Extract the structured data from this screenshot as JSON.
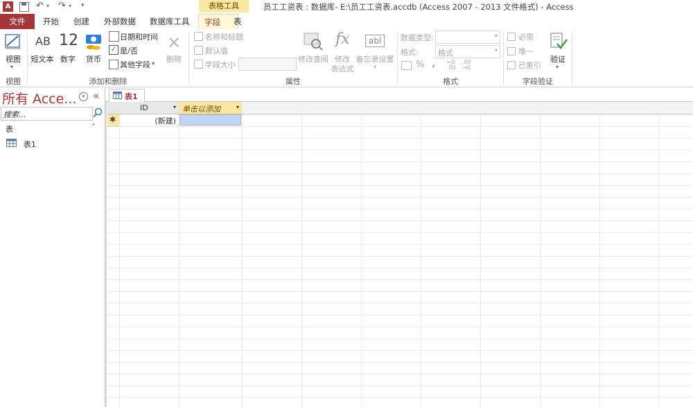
{
  "app": {
    "title": "员工工资表 : 数据库- E:\\员工工资表.accdb (Access 2007 - 2013 文件格式) - Access",
    "context_tab_header": "表格工具"
  },
  "tabs": [
    "文件",
    "开始",
    "创建",
    "外部数据",
    "数据库工具",
    "字段",
    "表"
  ],
  "active_tab": "字段",
  "ribbon": {
    "view": {
      "label": "视图",
      "group": "视图"
    },
    "add_delete": {
      "group": "添加和删除",
      "short_text": "短文本",
      "short_text_icon": "AB",
      "number": "数字",
      "number_icon": "12",
      "currency": "货币",
      "date_time": "日期和时间",
      "yes_no": "是/否",
      "more_fields": "其他字段",
      "delete": "删除"
    },
    "properties": {
      "group": "属性",
      "name_caption": "名称和标题",
      "default_value": "默认值",
      "field_size": "字段大小",
      "modify_lookups": "修改查阅",
      "modify_expression_1": "修改",
      "modify_expression_2": "表达式",
      "memo_settings": "备忘录设置",
      "fx": "fx",
      "abl": "abl"
    },
    "formatting": {
      "group": "格式",
      "data_type_label": "数据类型:",
      "format_label": "格式:",
      "format_value": "格式",
      "percent": "%",
      "comma": ",",
      "inc_dec": "←0 .00",
      "dec_dec": ".00 →0"
    },
    "validation": {
      "group": "字段验证",
      "required": "必需",
      "unique": "唯一",
      "indexed": "已索引",
      "validate": "验证"
    }
  },
  "nav_pane": {
    "title": "所有 Acce...",
    "search_placeholder": "搜索...",
    "section": "表",
    "items": [
      "表1"
    ]
  },
  "document": {
    "tab_label": "表1",
    "columns": [
      "ID",
      "单击以添加"
    ],
    "new_row_marker": "✱",
    "new_row_value": "(新建)"
  },
  "colors": {
    "accent": "#a4373a",
    "context_tab": "#fce9a4",
    "selected_cell": "#bcd8f8"
  }
}
